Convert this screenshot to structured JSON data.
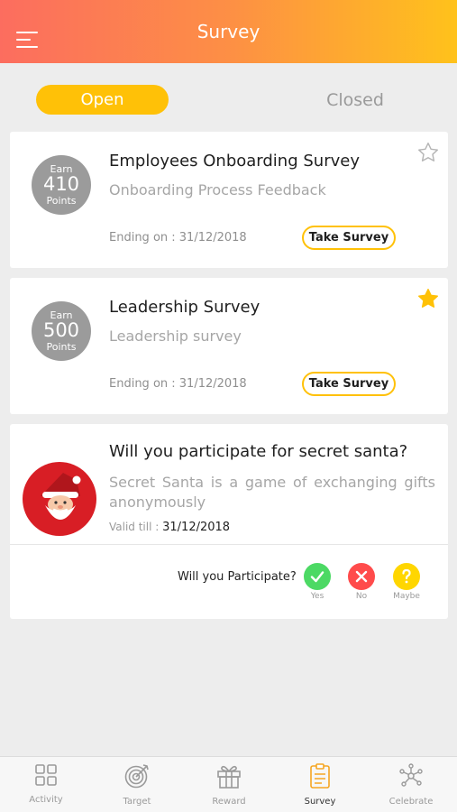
{
  "header": {
    "title": "Survey",
    "menu_icon": "hamburger-menu-icon",
    "gradient": [
      "#fc6d5f",
      "#ffc21b"
    ]
  },
  "tabs": {
    "open": "Open",
    "closed": "Closed",
    "active": "Open",
    "accent": "#ffc107"
  },
  "surveys": [
    {
      "earn_label": "Earn",
      "points": "410",
      "points_label": "Points",
      "title": "Employees Onboarding Survey",
      "subtitle": "Onboarding Process Feedback",
      "ending": "Ending on : 31/12/2018",
      "button": "Take Survey",
      "starred": false,
      "star_icon": "star-outline-icon"
    },
    {
      "earn_label": "Earn",
      "points": "500",
      "points_label": "Points",
      "title": "Leadership Survey",
      "subtitle": "Leadership survey",
      "ending": "Ending on : 31/12/2018",
      "button": "Take Survey",
      "starred": true,
      "star_icon": "star-filled-icon"
    }
  ],
  "poll": {
    "icon": "santa-icon",
    "title": "Will you participate for secret santa?",
    "description": "Secret Santa is a game of exchanging gifts anonymously",
    "valid_label": "Valid till :",
    "valid_date": "31/12/2018",
    "question": "Will you Participate?",
    "responses": {
      "yes": "Yes",
      "no": "No",
      "maybe": "Maybe"
    }
  },
  "bottom_nav": [
    {
      "label": "Activity",
      "icon": "grid-icon"
    },
    {
      "label": "Target",
      "icon": "target-icon"
    },
    {
      "label": "Reward",
      "icon": "gift-icon"
    },
    {
      "label": "Survey",
      "icon": "clipboard-icon",
      "active": true
    },
    {
      "label": "Celebrate",
      "icon": "network-icon"
    }
  ]
}
